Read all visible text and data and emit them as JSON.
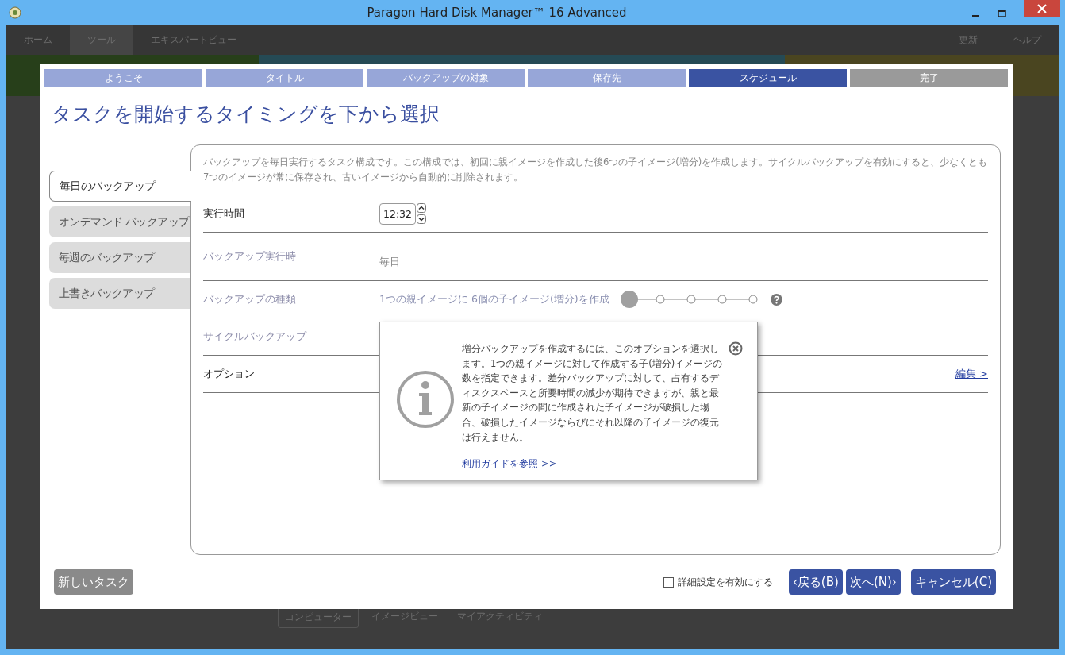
{
  "window": {
    "title": "Paragon Hard Disk Manager™ 16 Advanced"
  },
  "background_app": {
    "menu": [
      {
        "label": "ホーム",
        "selected": false
      },
      {
        "label": "ツール",
        "selected": true
      },
      {
        "label": "エキスパートビュー",
        "selected": false
      }
    ],
    "menu_right": [
      "更新",
      "ヘルプ"
    ],
    "bottom_tabs": [
      {
        "label": "コンピューター",
        "selected": true
      },
      {
        "label": "イメージビュー",
        "selected": false
      },
      {
        "label": "マイアクティビティ",
        "selected": false
      }
    ]
  },
  "wizard": {
    "steps": [
      {
        "label": "ようこそ",
        "completed": true,
        "selected": false
      },
      {
        "label": "タイトル",
        "completed": true,
        "selected": false
      },
      {
        "label": "バックアップの対象",
        "completed": true,
        "selected": false
      },
      {
        "label": "保存先",
        "completed": true,
        "selected": false
      },
      {
        "label": "スケジュール",
        "completed": false,
        "selected": true
      },
      {
        "label": "完了",
        "completed": false,
        "selected": false
      }
    ],
    "heading": "タスクを開始するタイミングを下から選択",
    "schedule_types": [
      {
        "label": "毎日のバックアップ",
        "selected": true
      },
      {
        "label": "オンデマンド バックアップ",
        "selected": false
      },
      {
        "label": "毎週のバックアップ",
        "selected": false
      },
      {
        "label": "上書きバックアップ",
        "selected": false
      }
    ],
    "description": "バックアップを毎日実行するタスク構成です。この構成では、初回に親イメージを作成した後6つの子イメージ(増分)を作成します。サイクルバックアップを有効にすると、少なくとも7つのイメージが常に保存され、古いイメージから自動的に削除されます。",
    "rows": [
      {
        "kind": "time",
        "label": "実行時間",
        "disabled": false,
        "value": "12:32"
      },
      {
        "kind": "text",
        "label": "バックアップ実行時",
        "disabled": true,
        "value": "毎日"
      },
      {
        "kind": "slider",
        "label": "バックアップの種類",
        "disabled": true,
        "value": "1つの親イメージに 6個の子イメージ(増分)を作成",
        "level": 0
      },
      {
        "kind": "plain",
        "label": "サイクルバックアップ",
        "disabled": true
      },
      {
        "kind": "link",
        "label": "オプション",
        "disabled": false,
        "link": "編集 >"
      }
    ],
    "tooltip": {
      "text": "増分バックアップを作成するには、このオプションを選択します。1つの親イメージに対して作成する子(増分)イメージの数を指定できます。差分バックアップに対して、占有するディスクスペースと所要時間の減少が期待できますが、親と最新の子イメージの間に作成された子イメージが破損した場合、破損したイメージならびにそれ以降の子イメージの復元は行えません。",
      "link": "利用ガイドを参照",
      "link_suffix": ">>"
    },
    "new_task_button": "新しいタスク",
    "advanced_checkbox": {
      "label": "詳細設定を有効にする",
      "checked": false
    },
    "buttons": [
      "‹戻る(B)",
      "次へ(N)›",
      "キャンセル(C)"
    ]
  }
}
